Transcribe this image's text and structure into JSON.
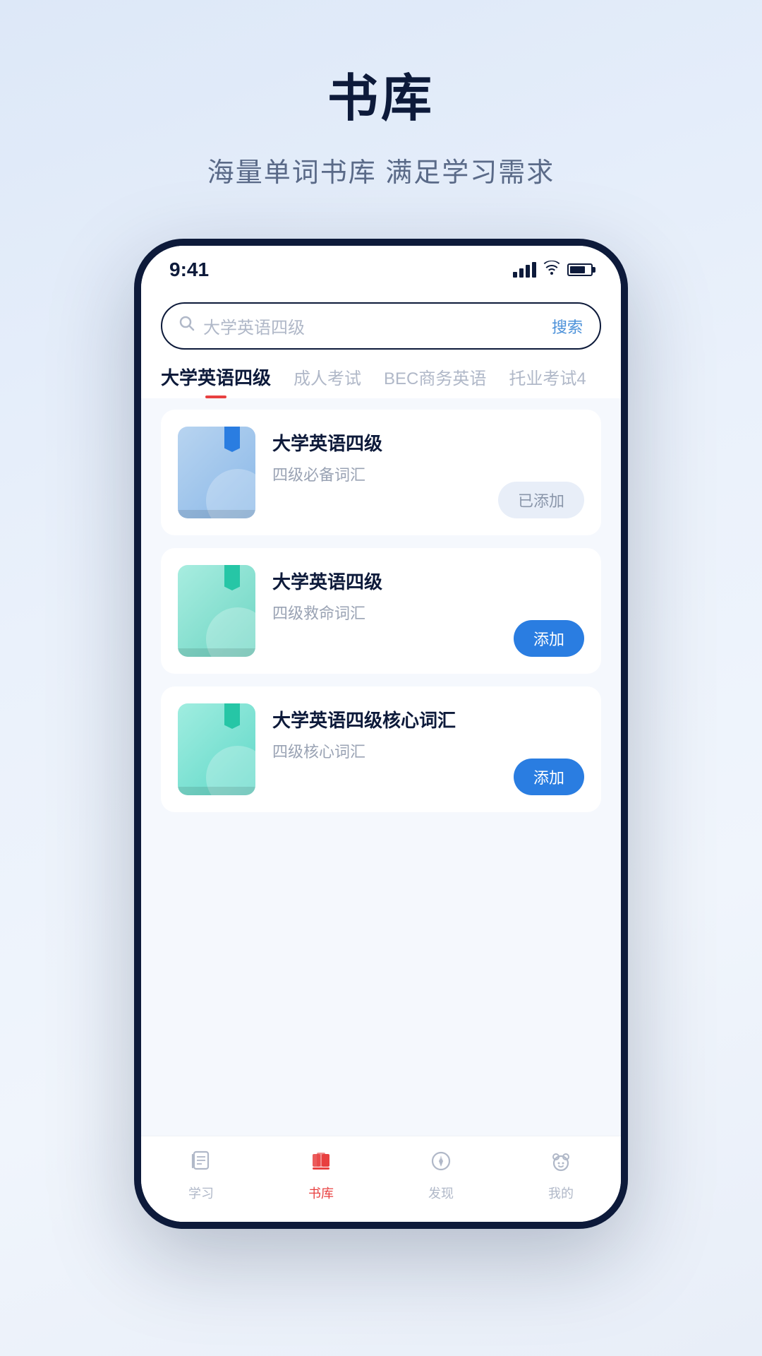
{
  "page": {
    "title": "书库",
    "subtitle": "海量单词书库 满足学习需求"
  },
  "status_bar": {
    "time": "9:41"
  },
  "search": {
    "placeholder": "大学英语四级",
    "button": "搜索"
  },
  "category_tabs": [
    {
      "label": "大学英语四级",
      "active": true
    },
    {
      "label": "成人考试",
      "active": false
    },
    {
      "label": "BEC商务英语",
      "active": false
    },
    {
      "label": "托业考试4",
      "active": false
    }
  ],
  "books": [
    {
      "title": "大学英语四级",
      "desc": "四级必备词汇",
      "action": "已添加",
      "action_type": "added",
      "cover_style": "1"
    },
    {
      "title": "大学英语四级",
      "desc": "四级救命词汇",
      "action": "添加",
      "action_type": "add",
      "cover_style": "2"
    },
    {
      "title": "大学英语四级核心词汇",
      "desc": "四级核心词汇",
      "action": "添加",
      "action_type": "add",
      "cover_style": "3"
    }
  ],
  "bottom_nav": [
    {
      "label": "学习",
      "active": false,
      "icon": "notebook"
    },
    {
      "label": "书库",
      "active": true,
      "icon": "books"
    },
    {
      "label": "发现",
      "active": false,
      "icon": "compass"
    },
    {
      "label": "我的",
      "active": false,
      "icon": "bear"
    }
  ]
}
